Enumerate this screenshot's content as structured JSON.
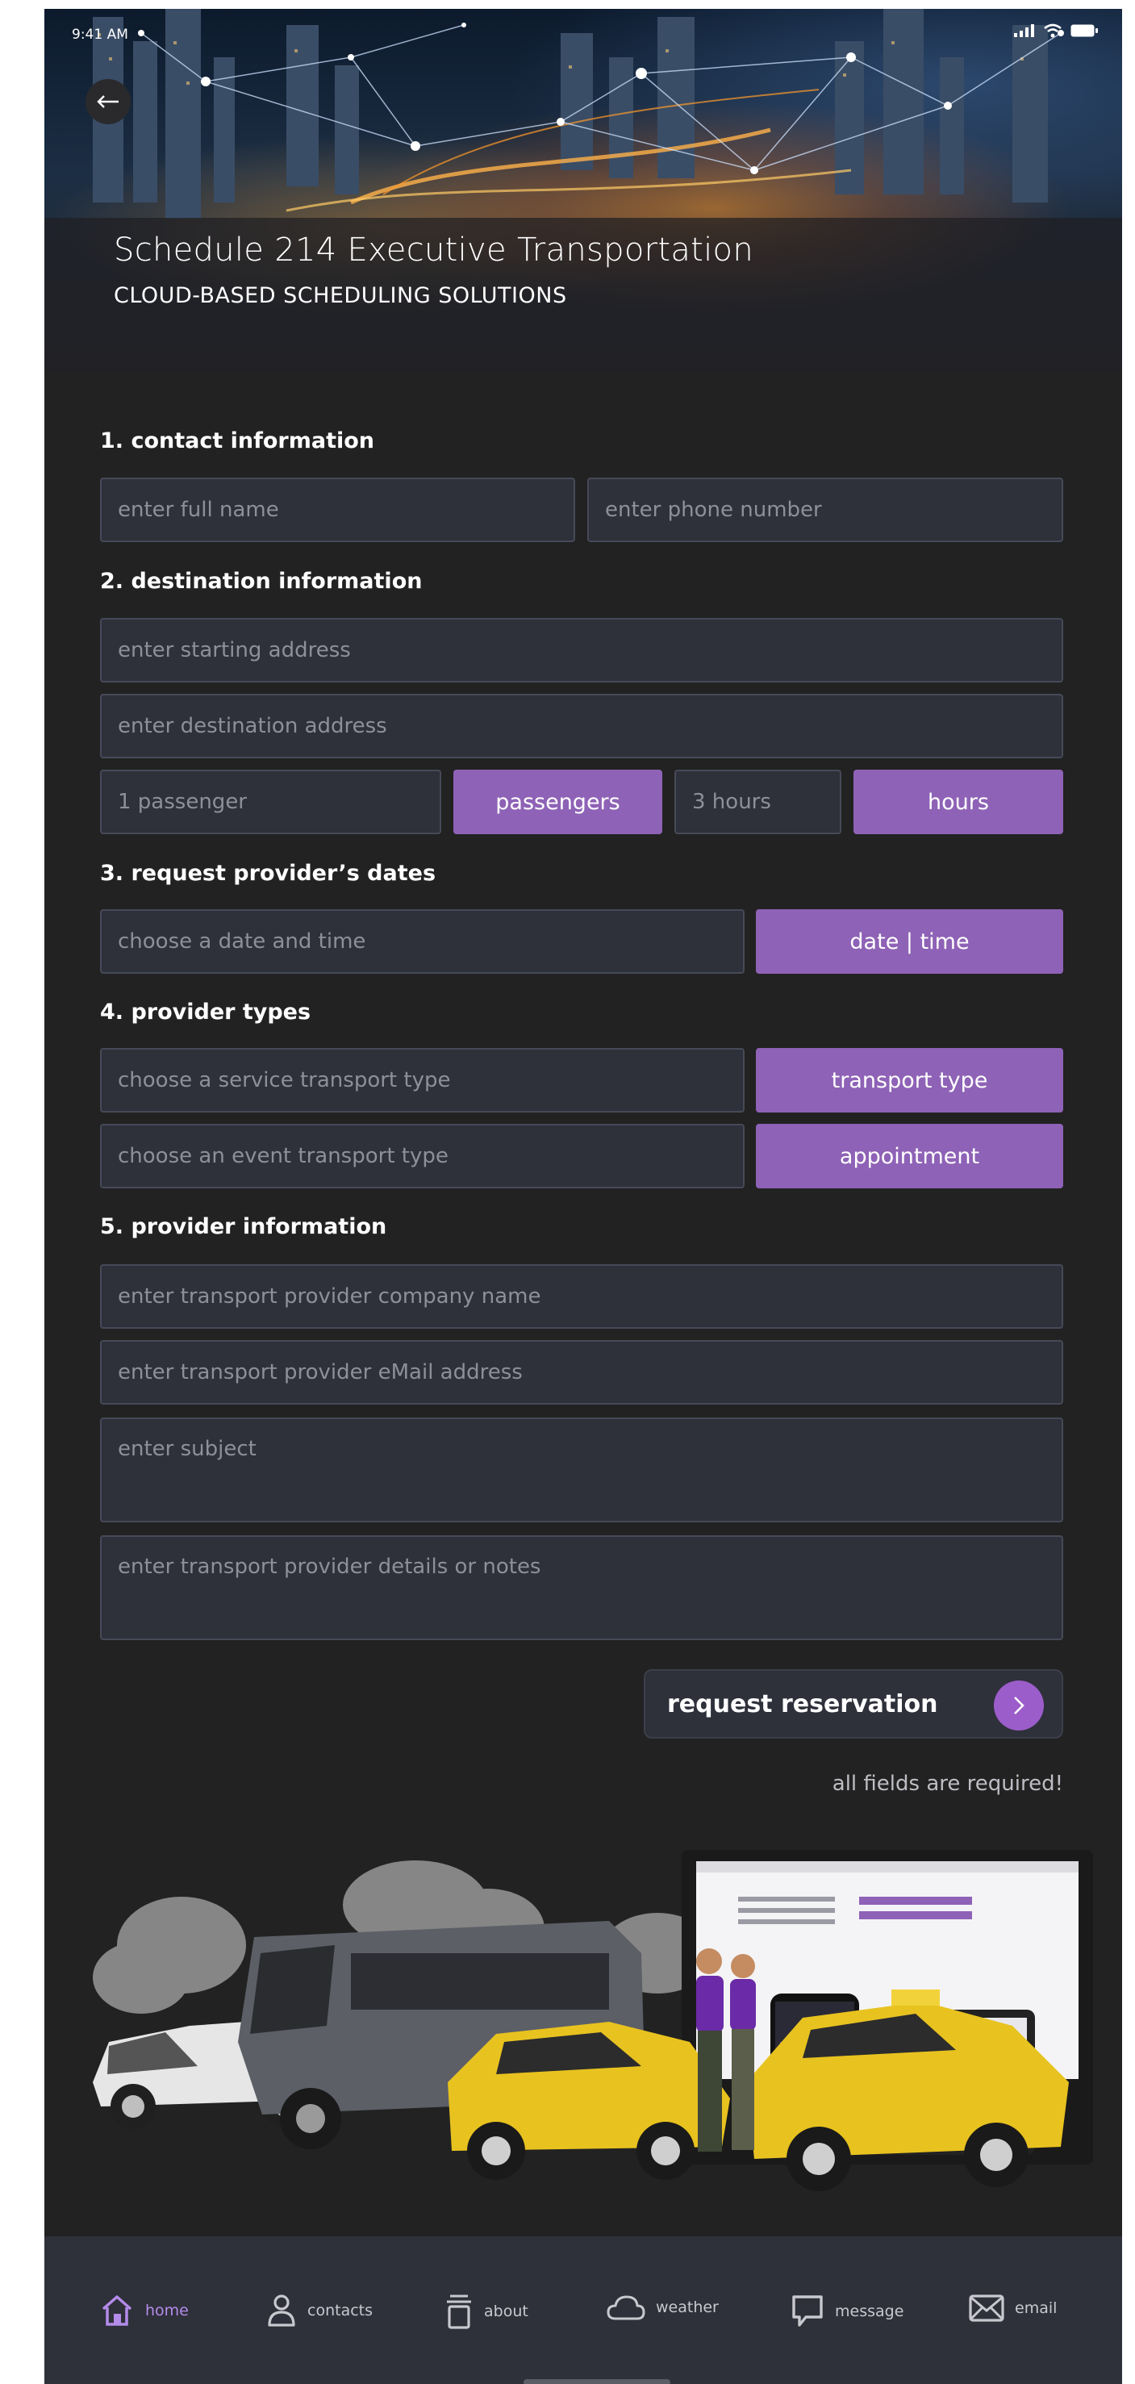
{
  "status_bar": {
    "time": "9:41 AM"
  },
  "header": {
    "title": "Schedule 214 Executive Transportation",
    "subtitle": "CLOUD-BASED SCHEDULING SOLUTIONS"
  },
  "form": {
    "sections": {
      "contact": "1. contact information",
      "destination": "2. destination information",
      "dates": "3. request provider’s dates",
      "types": "4. provider types",
      "provider": "5. provider information"
    },
    "full_name_placeholder": "enter full name",
    "phone_placeholder": "enter phone number",
    "start_address_placeholder": "enter starting address",
    "destination_address_placeholder": "enter destination address",
    "passengers_value": "1 passenger",
    "passengers_button": "passengers",
    "hours_value": "3 hours",
    "hours_button": "hours",
    "date_placeholder": "choose a date and time",
    "date_button": "date | time",
    "service_type_placeholder": "choose a service transport type",
    "service_type_button": "transport type",
    "event_type_placeholder": "choose an event transport type",
    "event_type_button": "appointment",
    "company_placeholder": "enter transport provider company name",
    "email_placeholder": "enter transport provider eMail address",
    "subject_placeholder": "enter subject",
    "notes_placeholder": "enter transport provider details or notes",
    "submit_label": "request reservation",
    "required_note": "all fields are required!"
  },
  "nav": {
    "items": [
      {
        "label": "home",
        "icon": "home-icon",
        "active": true
      },
      {
        "label": "contacts",
        "icon": "person-icon",
        "active": false
      },
      {
        "label": "about",
        "icon": "trash-icon",
        "active": false
      },
      {
        "label": "weather",
        "icon": "cloud-icon",
        "active": false
      },
      {
        "label": "message",
        "icon": "speech-bubble-icon",
        "active": false
      },
      {
        "label": "email",
        "icon": "envelope-icon",
        "active": false
      }
    ]
  },
  "colors": {
    "accent": "#8e62b6",
    "background": "#222222",
    "field_bg": "#2e303a",
    "field_border": "#464a58",
    "nav_active": "#b48cea"
  }
}
